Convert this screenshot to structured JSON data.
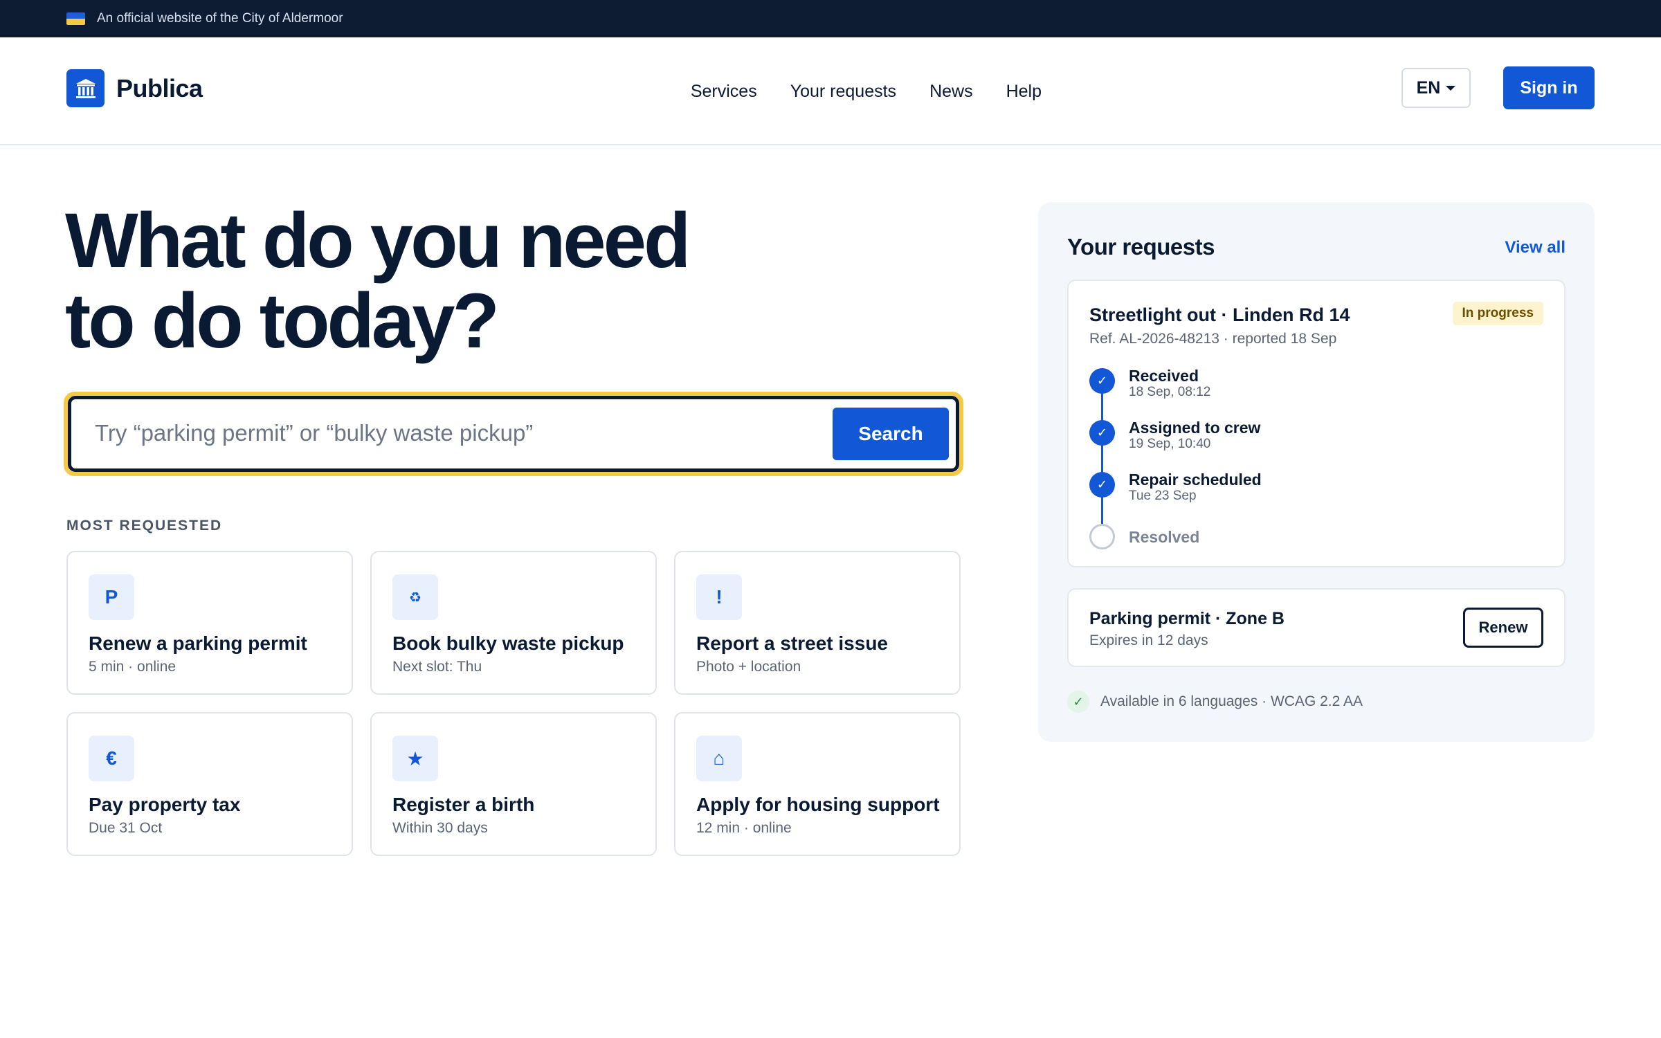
{
  "gov_banner": {
    "text": "An official website of the City of Aldermoor"
  },
  "header": {
    "brand": "Publica",
    "nav": [
      {
        "label": "Services"
      },
      {
        "label": "Your requests"
      },
      {
        "label": "News"
      },
      {
        "label": "Help"
      }
    ],
    "language": "EN",
    "sign_in": "Sign in"
  },
  "hero": {
    "title_line1": "What do you need",
    "title_line2": "to do today?"
  },
  "search": {
    "placeholder": "Try “parking permit” or “bulky waste pickup”",
    "button": "Search"
  },
  "most_requested": {
    "label": "MOST REQUESTED",
    "cards": [
      {
        "icon": "P",
        "icon_name": "parking-icon",
        "title": "Renew a parking permit",
        "sub": "5 min · online"
      },
      {
        "icon": "♻",
        "icon_name": "recycle-icon",
        "title": "Book bulky waste pickup",
        "sub": "Next slot: Thu"
      },
      {
        "icon": "!",
        "icon_name": "alert-icon",
        "title": "Report a street issue",
        "sub": "Photo + location"
      },
      {
        "icon": "€",
        "icon_name": "euro-icon",
        "title": "Pay property tax",
        "sub": "Due 31 Oct"
      },
      {
        "icon": "★",
        "icon_name": "star-icon",
        "title": "Register a birth",
        "sub": "Within 30 days"
      },
      {
        "icon": "⌂",
        "icon_name": "home-icon",
        "title": "Apply for housing support",
        "sub": "12 min · online"
      }
    ]
  },
  "requests_panel": {
    "title": "Your requests",
    "view_all": "View all",
    "request": {
      "title": "Streetlight out · Linden Rd 14",
      "ref": "Ref. AL-2026-48213 · reported 18 Sep",
      "status": "In progress",
      "steps": [
        {
          "label": "Received",
          "time": "18 Sep, 08:12",
          "done": true
        },
        {
          "label": "Assigned to crew",
          "time": "19 Sep, 10:40",
          "done": true
        },
        {
          "label": "Repair scheduled",
          "time": "Tue 23 Sep",
          "done": true
        },
        {
          "label": "Resolved",
          "time": "",
          "done": false
        }
      ]
    },
    "permit": {
      "title": "Parking permit · Zone B",
      "sub": "Expires in 12 days",
      "button": "Renew"
    },
    "availability": "Available in 6 languages · WCAG 2.2 AA"
  },
  "colors": {
    "brand_blue": "#1257d6",
    "dark_navy": "#0d1b33",
    "focus_yellow": "#f6c945",
    "status_badge_bg": "#fdf3cf"
  }
}
